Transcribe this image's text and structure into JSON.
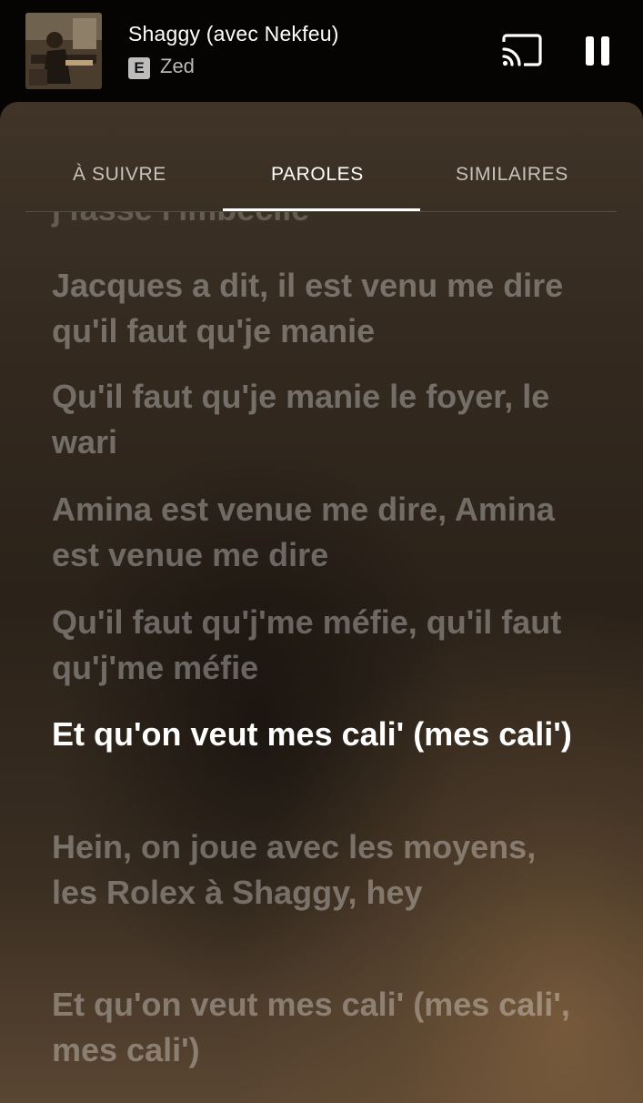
{
  "player": {
    "track_title": "Shaggy (avec Nekfeu)",
    "explicit_badge": "E",
    "artist": "Zed",
    "cast_icon": "cast-icon",
    "pause_icon": "pause-icon"
  },
  "tabs": [
    {
      "label": "À SUIVRE",
      "active": false
    },
    {
      "label": "PAROLES",
      "active": true
    },
    {
      "label": "SIMILAIRES",
      "active": false
    }
  ],
  "lyrics": [
    {
      "text": "j'fasse l'imbécile",
      "state": "partial"
    },
    {
      "text": "Jacques a dit, il est venu me dire qu'il faut qu'je manie",
      "state": "inactive"
    },
    {
      "text": "Qu'il faut qu'je manie le foyer, le wari",
      "state": "inactive"
    },
    {
      "text": "Amina est venue me dire, Amina est venue me dire",
      "state": "inactive"
    },
    {
      "text": "Qu'il faut qu'j'me méfie, qu'il faut qu'j'me méfie",
      "state": "inactive"
    },
    {
      "text": "Et qu'on veut mes cali' (mes cali')",
      "state": "current"
    },
    {
      "text": "Hein, on joue avec les moyens, les Rolex à Shaggy, hey",
      "state": "inactive"
    },
    {
      "text": "Et qu'on veut mes cali' (mes cali', mes cali')",
      "state": "inactive"
    }
  ]
}
